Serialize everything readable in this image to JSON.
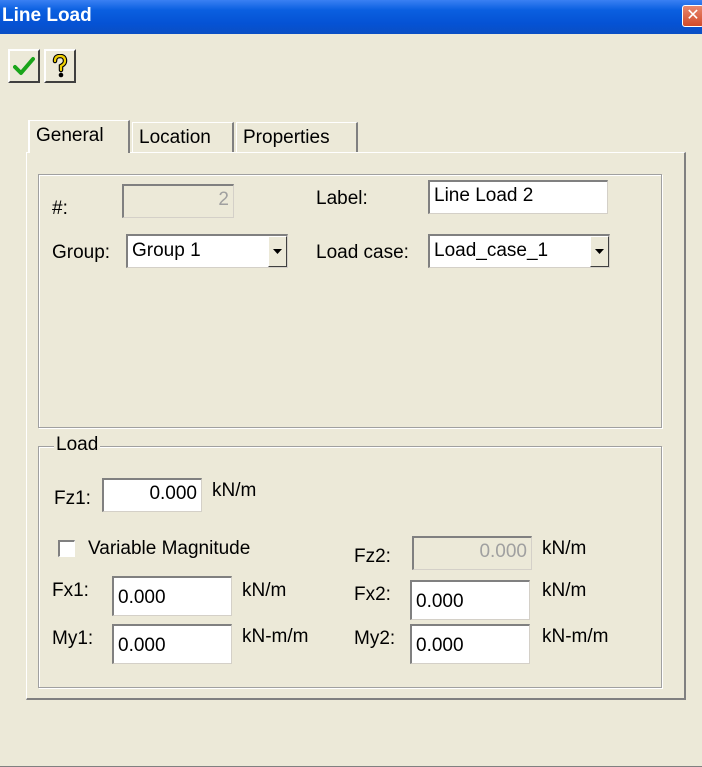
{
  "window": {
    "title": "Line Load",
    "close_glyph": "✕"
  },
  "toolbar": {
    "ok_icon": "checkmark-icon",
    "help_icon": "help-question-icon",
    "ok_color": "#1aa51a",
    "help_color": "#e8c800"
  },
  "tabs": [
    {
      "label": "General",
      "active": true
    },
    {
      "label": "Location",
      "active": false
    },
    {
      "label": "Properties",
      "active": false
    }
  ],
  "general": {
    "number_label": "#:",
    "number_value": "2",
    "label_label": "Label:",
    "label_value": "Line Load 2",
    "group_label": "Group:",
    "group_value": "Group 1",
    "loadcase_label": "Load case:",
    "loadcase_value": "Load_case_1"
  },
  "load": {
    "legend": "Load",
    "fz1_label": "Fz1:",
    "fz1_value": "0.000",
    "fz1_unit": "kN/m",
    "variable_label": "Variable Magnitude",
    "variable_checked": false,
    "fz2_label": "Fz2:",
    "fz2_value": "0.000",
    "fz2_unit": "kN/m",
    "fx1_label": "Fx1:",
    "fx1_value": "0.000",
    "fx1_unit": "kN/m",
    "fx2_label": "Fx2:",
    "fx2_value": "0.000",
    "fx2_unit": "kN/m",
    "my1_label": "My1:",
    "my1_value": "0.000",
    "my1_unit": "kN-m/m",
    "my2_label": "My2:",
    "my2_value": "0.000",
    "my2_unit": "kN-m/m"
  }
}
